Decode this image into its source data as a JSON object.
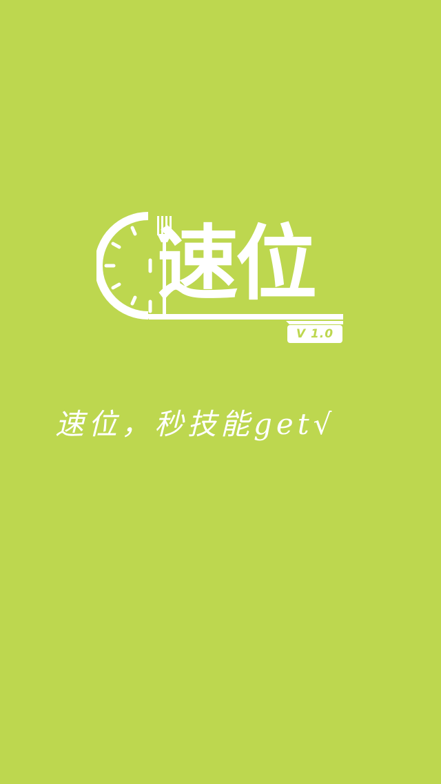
{
  "app": {
    "logo_text": "速位",
    "version": "V  1.0",
    "slogan": "速位，秒技能get√"
  },
  "colors": {
    "background": "#BDD74F",
    "foreground": "#FFFFFF"
  },
  "icons": {
    "clock": "clock-icon",
    "fork": "fork-icon"
  }
}
